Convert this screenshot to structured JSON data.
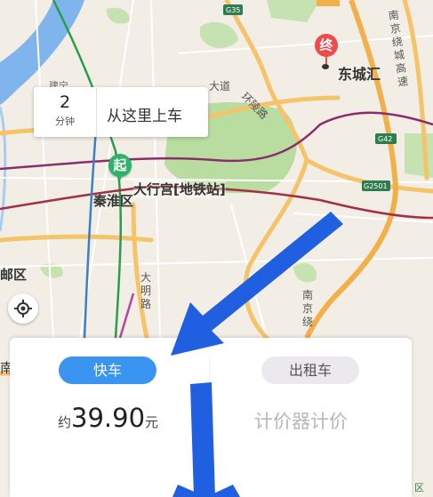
{
  "map": {
    "labels": {
      "dongcheng": "东城汇",
      "qinhuai": "秦淮区",
      "daxinggong": "大行宫[地铁站]",
      "huanling": "环陵路",
      "daming": "大明路",
      "dadao": "大道",
      "nanjingrao_top": "南京绕城高速",
      "nanjingrao_bottom": "南京绕",
      "jianye": "建宁",
      "youqu": "邮区",
      "nan": "南",
      "g35": "G35",
      "g42": "G42",
      "g2501": "G2501",
      "edge_br": "区"
    },
    "start_marker": "起",
    "end_marker": "终"
  },
  "bubble": {
    "minutes": "2",
    "unit": "分钟",
    "board_text": "从这里上车"
  },
  "panel": {
    "tab_fast": "快车",
    "tab_taxi": "出租车",
    "price_prefix": "约",
    "price_value": "39.90",
    "price_suffix": "元",
    "meter_text": "计价器计价"
  },
  "colors": {
    "accent": "#3a95f0",
    "start": "#2db36b",
    "end": "#ee4c4c",
    "annotation_arrow": "#1f5fe0"
  }
}
